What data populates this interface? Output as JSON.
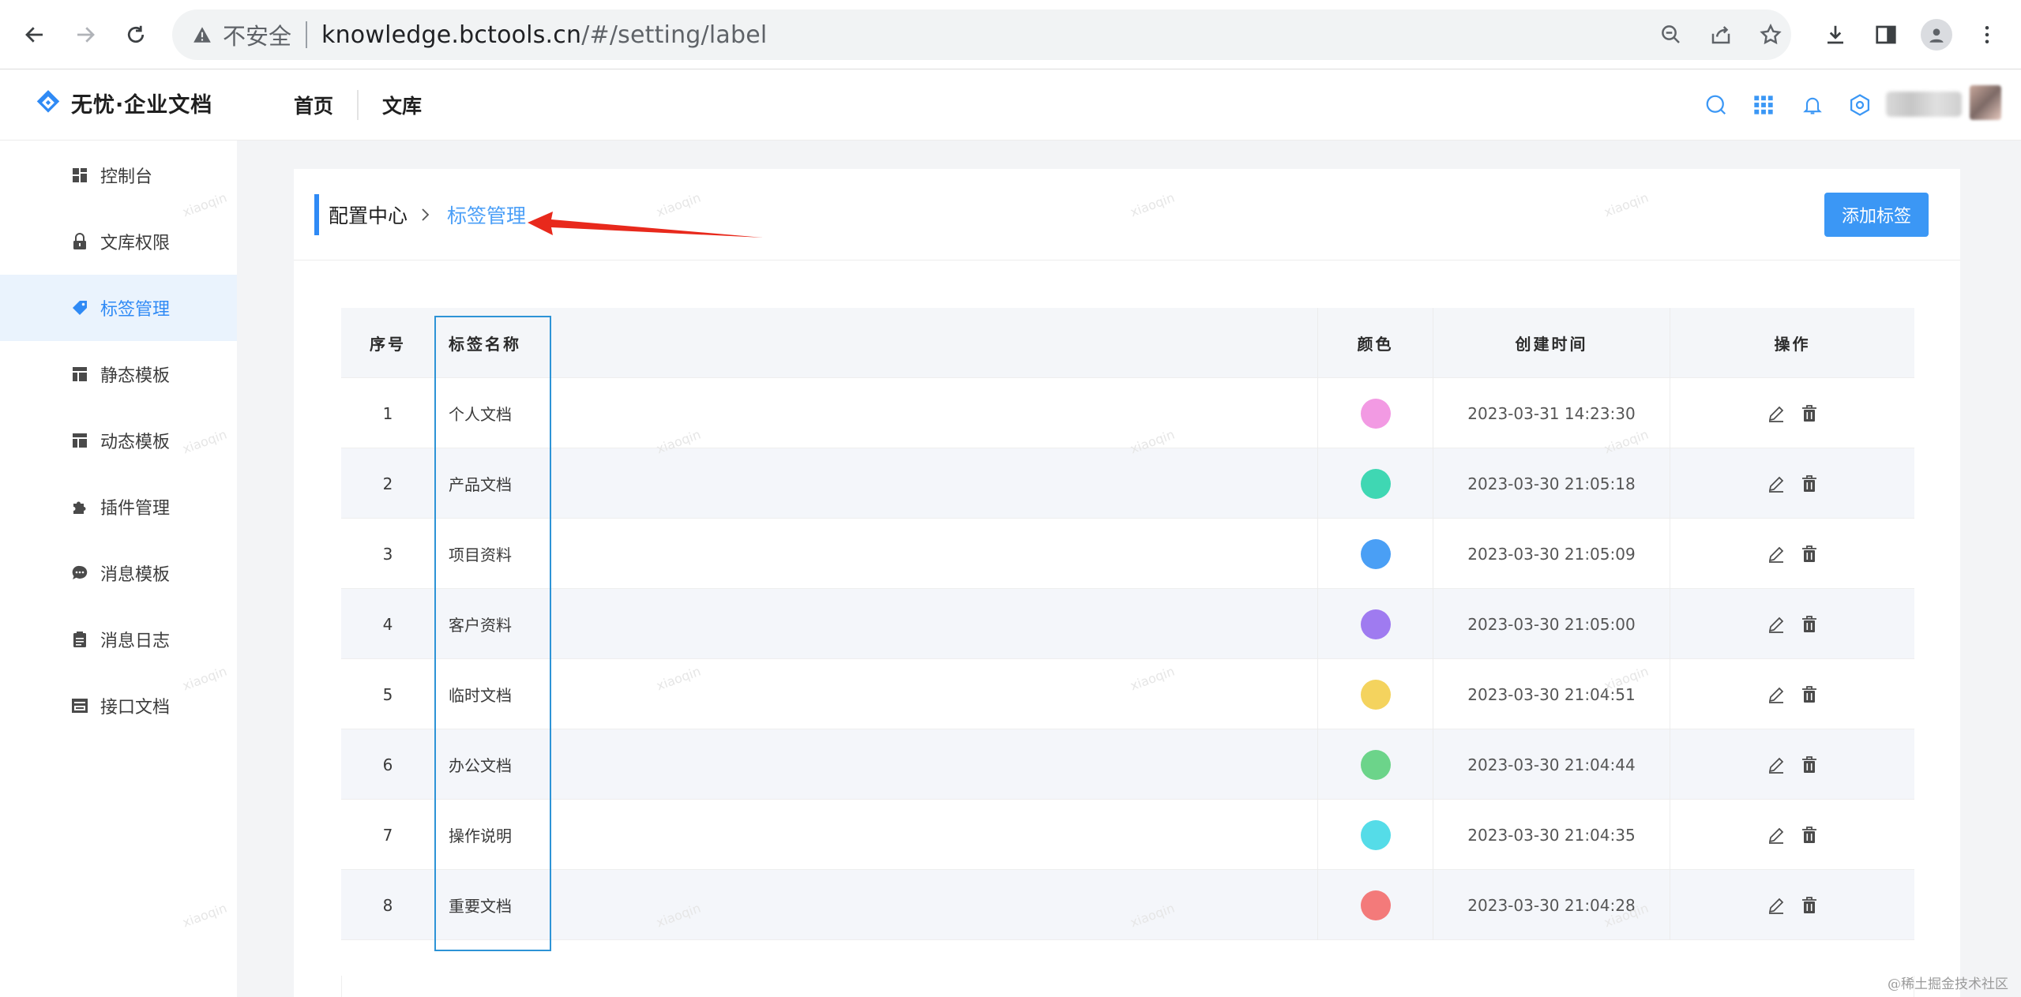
{
  "browser": {
    "insecure_label": "不安全",
    "url_host": "knowledge.bctools.cn",
    "url_path": "/#/setting/label"
  },
  "app": {
    "brand": "无忧·企业文档",
    "nav": [
      "首页",
      "文库"
    ]
  },
  "sidebar": {
    "items": [
      {
        "label": "控制台",
        "icon": "dashboard-icon",
        "active": false
      },
      {
        "label": "文库权限",
        "icon": "lock-icon",
        "active": false
      },
      {
        "label": "标签管理",
        "icon": "tag-icon",
        "active": true
      },
      {
        "label": "静态模板",
        "icon": "template-icon",
        "active": false
      },
      {
        "label": "动态模板",
        "icon": "template-icon",
        "active": false
      },
      {
        "label": "插件管理",
        "icon": "puzzle-icon",
        "active": false
      },
      {
        "label": "消息模板",
        "icon": "chat-icon",
        "active": false
      },
      {
        "label": "消息日志",
        "icon": "clipboard-icon",
        "active": false
      },
      {
        "label": "接口文档",
        "icon": "api-doc-icon",
        "active": false
      }
    ]
  },
  "breadcrumb": {
    "parent": "配置中心",
    "current": "标签管理"
  },
  "add_button_label": "添加标签",
  "table": {
    "columns": {
      "index": "序号",
      "name": "标签名称",
      "color": "颜色",
      "created": "创建时间",
      "ops": "操作"
    },
    "rows": [
      {
        "index": "1",
        "name": "个人文档",
        "color": "#f29ae3",
        "created": "2023-03-31 14:23:30"
      },
      {
        "index": "2",
        "name": "产品文档",
        "color": "#3fd7b3",
        "created": "2023-03-30 21:05:18"
      },
      {
        "index": "3",
        "name": "项目资料",
        "color": "#4a9ff5",
        "created": "2023-03-30 21:05:09"
      },
      {
        "index": "4",
        "name": "客户资料",
        "color": "#9f7bf0",
        "created": "2023-03-30 21:05:00"
      },
      {
        "index": "5",
        "name": "临时文档",
        "color": "#f4d35e",
        "created": "2023-03-30 21:04:51"
      },
      {
        "index": "6",
        "name": "办公文档",
        "color": "#6cd48a",
        "created": "2023-03-30 21:04:44"
      },
      {
        "index": "7",
        "name": "操作说明",
        "color": "#55dce8",
        "created": "2023-03-30 21:04:35"
      },
      {
        "index": "8",
        "name": "重要文档",
        "color": "#f37a7a",
        "created": "2023-03-30 21:04:28"
      }
    ]
  },
  "watermark_text": "xiaoqin",
  "credit": "@稀土掘金技术社区",
  "colors": {
    "accent": "#2f8af5",
    "button": "#3b97f5",
    "annotation_arrow": "#e8291c",
    "annotation_box": "#2d93d6"
  }
}
